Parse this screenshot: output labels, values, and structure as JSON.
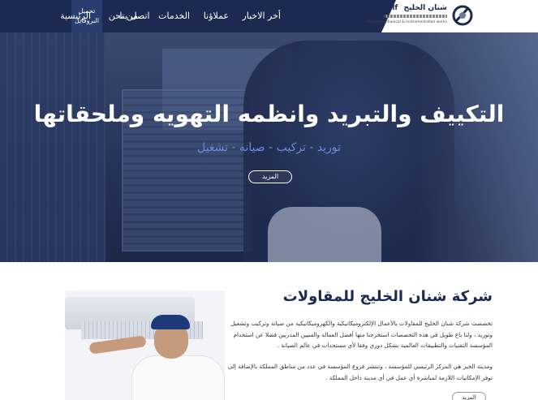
{
  "brand": {
    "name_ar": "شنان الخليج",
    "name_en": "Shinan Gulf",
    "tagline": "Electromechanical & Instrumentation works"
  },
  "nav": {
    "download_line1": "تحميل",
    "download_line2": "البروفايل",
    "items": [
      "الرئيسية",
      "من نحن",
      "الخدمات",
      "عملاؤنا",
      "أخر الاخبار",
      "اتصل بنا"
    ]
  },
  "hero": {
    "title": "التكييف والتبريد وانظمه التهويه وملحقاتها",
    "subtitle": "توريد - تركيب - صيانه - تشغيل",
    "button": "المزيد"
  },
  "about": {
    "title": "شركة شنان الخليج للمقاولات",
    "paragraph1": "تخصصت شركة شنان الخليج للمقاولات بالأعمال الإلكتروميكانيكية والكهروميكانيكية من صيانة وتركيب وتشغيل وتوريد ، ولنا باع طويل في هذه التخصصات استخرجنا منها أفضل العمالة والفنيين المدربين فضلا عن استخدام المؤسسة التقنيات والتطبيقات العالمية بشكل دوري وفقا لأي مستجدات في عالم الصيانة .",
    "paragraph2": "ومدينة الخبر هي المركز الرئيسي للمؤسسة ، وتنتشر فروع المؤسسة في عدد من مناطق المملكة بالإضافة إلى توفر الإمكانيات اللازمة لمباشرة أي عمل في أي مدينة داخل المملكة .",
    "button": "المزيد"
  }
}
